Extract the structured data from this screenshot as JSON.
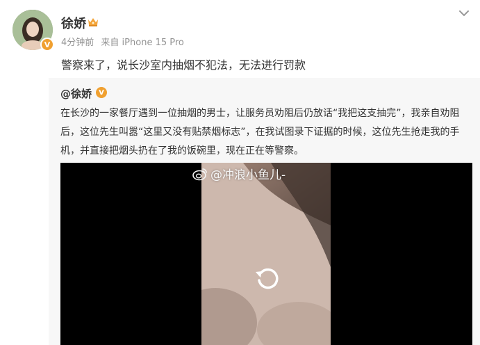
{
  "header": {
    "username": "徐娇",
    "time_ago": "4分钟前",
    "source": "来自 iPhone 15 Pro"
  },
  "post": {
    "text": "警察来了，说长沙室内抽烟不犯法，无法进行罚款"
  },
  "repost": {
    "author": "@徐娇",
    "body": "在长沙的一家餐厅遇到一位抽烟的男士，让服务员劝阻后仍放话“我把这支抽完”，我亲自劝阻后，这位先生叫嚣“这里又没有贴禁烟标志”，在我试图录下证据的时候，这位先生抢走我的手机，并直接把烟头扔在了我的饭碗里，现在正在等警察。",
    "video": {
      "watermark": "@冲浪小鱼儿-"
    }
  },
  "colors": {
    "accent_badge": "#f0a030",
    "meta_text": "#939393",
    "repost_bg": "#f7f7f7"
  },
  "icons": {
    "verified": "verified-badge-icon",
    "crown": "crown-icon",
    "more": "chevron-down-icon",
    "replay": "replay-icon",
    "weibo": "weibo-logo-icon"
  }
}
